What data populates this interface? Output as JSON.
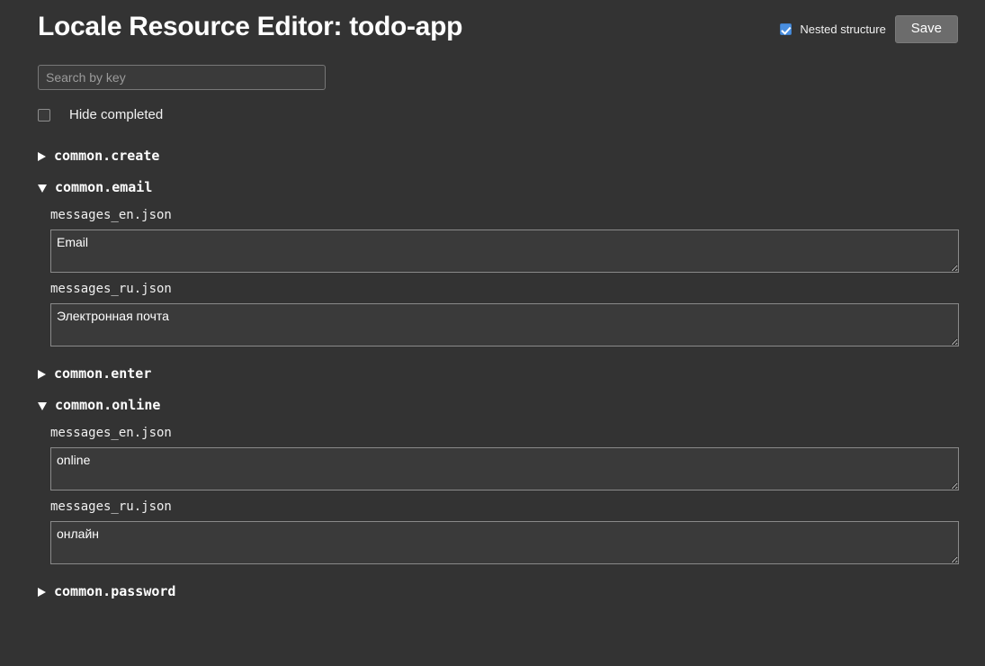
{
  "header": {
    "title": "Locale Resource Editor: todo-app",
    "nested_structure_label": "Nested structure",
    "nested_structure_checked": true,
    "save_label": "Save"
  },
  "toolbar": {
    "search_placeholder": "Search by key",
    "search_value": "",
    "hide_completed_label": "Hide completed",
    "hide_completed_checked": false
  },
  "colors": {
    "background": "#333333",
    "accent": "#4a8fe0",
    "button": "#6c6c6c",
    "field_background": "#3a3a3a",
    "field_border": "#8a8a8a",
    "placeholder": "#9b9b9b"
  },
  "entries": [
    {
      "key": "common.create",
      "expanded": false,
      "marker": "▶",
      "fields": []
    },
    {
      "key": "common.email",
      "expanded": true,
      "marker": "▼",
      "fields": [
        {
          "file": "messages_en.json",
          "value": "Email"
        },
        {
          "file": "messages_ru.json",
          "value": "Электронная почта"
        }
      ]
    },
    {
      "key": "common.enter",
      "expanded": false,
      "marker": "▶",
      "fields": []
    },
    {
      "key": "common.online",
      "expanded": true,
      "marker": "▼",
      "fields": [
        {
          "file": "messages_en.json",
          "value": "online"
        },
        {
          "file": "messages_ru.json",
          "value": "онлайн"
        }
      ]
    },
    {
      "key": "common.password",
      "expanded": false,
      "marker": "▶",
      "fields": []
    }
  ]
}
